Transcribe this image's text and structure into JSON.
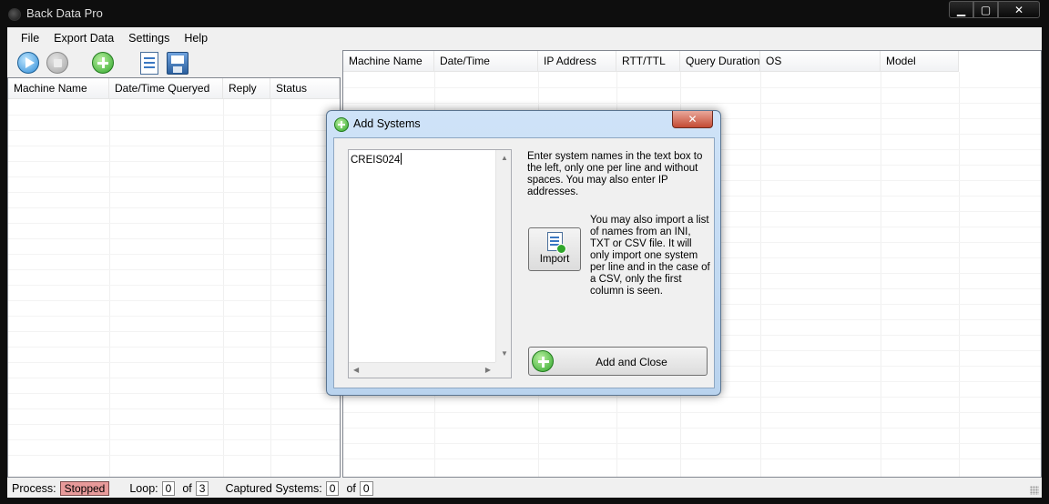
{
  "window": {
    "title": "Back Data Pro",
    "min_glyph": "▁",
    "max_glyph": "▢",
    "close_glyph": "✕"
  },
  "menu": [
    "File",
    "Export Data",
    "Settings",
    "Help"
  ],
  "toolbar": {
    "icons": [
      "play-icon",
      "stop-icon",
      "add-icon",
      "report-icon",
      "save-icon"
    ]
  },
  "left_list": {
    "columns": [
      "Machine Name",
      "Date/Time Queryed",
      "Reply",
      "Status"
    ]
  },
  "right_list": {
    "columns": [
      "Machine Name",
      "Date/Time",
      "IP Address",
      "RTT/TTL",
      "Query Duration",
      "OS",
      "Model"
    ]
  },
  "status": {
    "process_label": "Process:",
    "process_value": "Stopped",
    "loop_label": "Loop:",
    "loop_current": "0",
    "loop_of": "of",
    "loop_total": "3",
    "captured_label": "Captured Systems:",
    "captured_current": "0",
    "captured_of": "of",
    "captured_total": "0",
    "stopped_color": "#e89a9a"
  },
  "dialog": {
    "title": "Add Systems",
    "close_glyph": "✕",
    "names_value": "CREIS024",
    "info_text": "Enter system names in the text box to the left, only one per line and without spaces. You may also enter IP addresses.",
    "import_label": "Import",
    "import_info": "You may also import a list of names from an  INI, TXT or CSV file. It will only import one system per line and in the case of a CSV, only the first column is seen.",
    "add_close_label": "Add and Close"
  }
}
